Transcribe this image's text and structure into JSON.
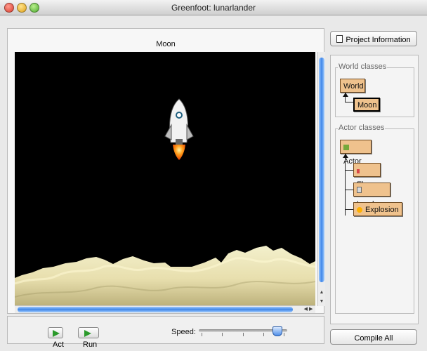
{
  "window": {
    "title": "Greenfoot: lunarlander"
  },
  "world": {
    "name": "Moon"
  },
  "controls": {
    "act_label": "Act",
    "run_label": "Run",
    "speed_label": "Speed:",
    "speed_level": 0.88
  },
  "sidebar": {
    "project_info_label": "Project Information",
    "world_classes_title": "World classes",
    "world_classes": [
      "World",
      "Moon"
    ],
    "actor_classes_title": "Actor classes",
    "actor_classes": [
      "Actor",
      "Flag",
      "Lander",
      "Explosion"
    ],
    "compile_label": "Compile All"
  },
  "colors": {
    "sky": "#000000",
    "ground": "#f0e8b8",
    "class_fill": "#efc28d",
    "scroll_blue": "#3f86e8"
  },
  "icons": [
    "close-window-icon",
    "minimize-window-icon",
    "zoom-window-icon",
    "document-icon",
    "play-icon",
    "rocket-icon"
  ]
}
